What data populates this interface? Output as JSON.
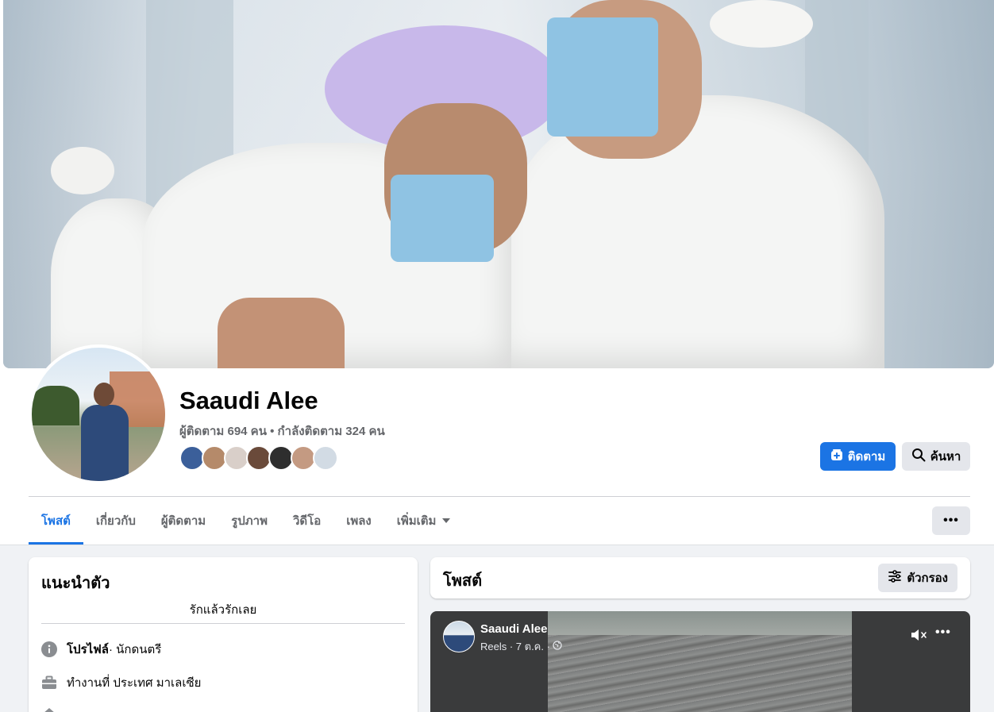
{
  "profile": {
    "name": "Saaudi Alee",
    "followers_text": "ผู้ติดตาม 694 คน • กำลังติดตาม 324 คน",
    "friend_thumb_colors": [
      "#3b5f9a",
      "#b58a6a",
      "#d9cfc9",
      "#6a4a3a",
      "#2e2e2e",
      "#c49a82",
      "#d2dbe4"
    ]
  },
  "actions": {
    "follow_label": "ติดตาม",
    "search_label": "ค้นหา",
    "more_label": "•••"
  },
  "tabs": [
    {
      "label": "โพสต์"
    },
    {
      "label": "เกี่ยวกับ"
    },
    {
      "label": "ผู้ติดตาม"
    },
    {
      "label": "รูปภาพ"
    },
    {
      "label": "วิดีโอ"
    },
    {
      "label": "เพลง"
    },
    {
      "label": "เพิ่มเติม"
    }
  ],
  "intro": {
    "title": "แนะนำตัว",
    "bio": "รักแล้วรักเลย",
    "profile_label": "โปรไฟล์",
    "profile_category": " · นักดนตรี",
    "work": "ทำงานที่ ประเทศ มาเลเซีย"
  },
  "posts": {
    "title": "โพสต์",
    "filter_label": "ตัวกรอง"
  },
  "reel": {
    "author": "Saaudi Alee",
    "meta": "Reels · 7 ต.ค. ·"
  },
  "colors": {
    "accent": "#1b74e4",
    "button_gray": "#e4e6eb",
    "text_secondary": "#65676b"
  }
}
